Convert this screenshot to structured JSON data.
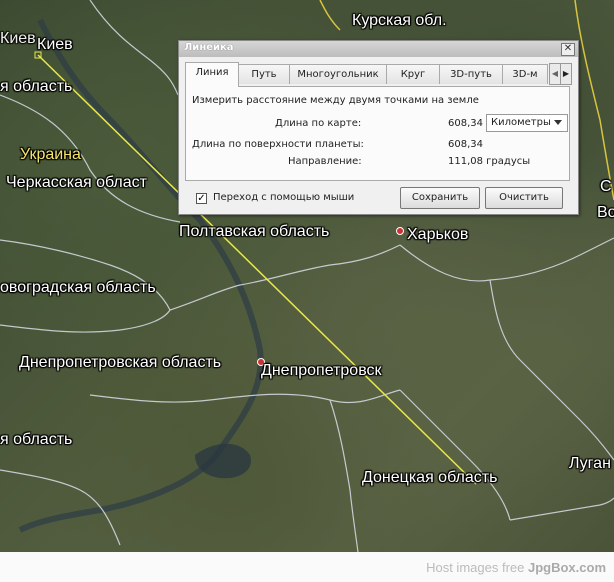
{
  "map": {
    "country_label": "Украина",
    "regions": [
      {
        "id": "kursk",
        "label": "Курская обл."
      },
      {
        "id": "kiev-oblast",
        "label": "я область"
      },
      {
        "id": "cherkasy",
        "label": "Черкасская област"
      },
      {
        "id": "poltava",
        "label": "Полтавская область"
      },
      {
        "id": "kirovograd",
        "label": "овоградская область"
      },
      {
        "id": "dnepr-oblast",
        "label": "Днепропетровская область"
      },
      {
        "id": "zapor-oblast",
        "label": "я область"
      },
      {
        "id": "donetsk",
        "label": "Донецкая область"
      },
      {
        "id": "right-edge-1",
        "label": "С"
      },
      {
        "id": "right-edge-2",
        "label": "Во"
      }
    ],
    "cities": [
      {
        "id": "kiev",
        "label": "Киев"
      },
      {
        "id": "kiev-left",
        "label": "Киев"
      },
      {
        "id": "kharkov",
        "label": "Харьков"
      },
      {
        "id": "dnepropetrovsk",
        "label": "Днепропетровск"
      },
      {
        "id": "lugansk",
        "label": "Луган"
      }
    ],
    "measure_line_color": "#e8e84a"
  },
  "dialog": {
    "title": "Линейка",
    "close_label": "✕",
    "tabs": [
      "Линия",
      "Путь",
      "Многоугольник",
      "Круг",
      "3D-путь",
      "3D-м"
    ],
    "active_tab": "Линия",
    "scroll_left": "◀",
    "scroll_right": "▶",
    "description": "Измерить расстояние между двумя точками на земле",
    "map_length_label": "Длина по карте:",
    "map_length_value": "608,34",
    "unit_selected": "Километры",
    "surface_length_label": "Длина по поверхности планеты:",
    "surface_length_value": "608,34",
    "direction_label": "Направление:",
    "direction_value": "111,08 градусы",
    "mouse_nav_checked": "✓",
    "mouse_nav_label": "Переход с помощью мыши",
    "save_label": "Сохранить",
    "clear_label": "Очистить"
  },
  "footer": {
    "prefix": "Host images free",
    "brand": "JpgBox.com"
  }
}
